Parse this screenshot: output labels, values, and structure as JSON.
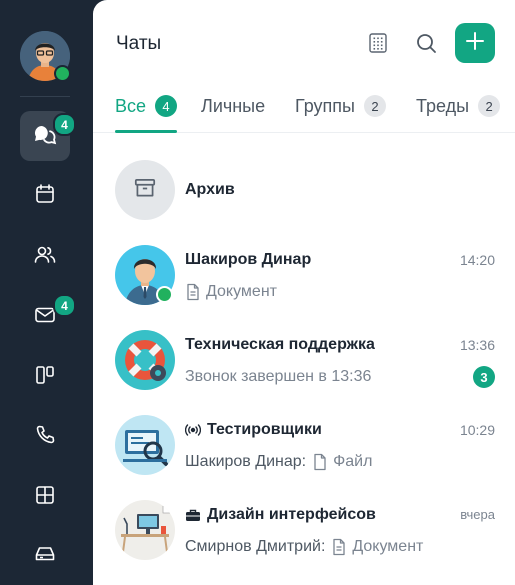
{
  "header": {
    "title": "Чаты"
  },
  "sidebar": {
    "chats_badge": "4",
    "mail_badge": "4"
  },
  "tabs": [
    {
      "label": "Все",
      "count": "4"
    },
    {
      "label": "Личные",
      "count": ""
    },
    {
      "label": "Группы",
      "count": "2"
    },
    {
      "label": "Треды",
      "count": "2"
    }
  ],
  "archive": {
    "label": "Архив"
  },
  "chats": [
    {
      "name": "Шакиров Динар",
      "time": "14:20",
      "sender": "",
      "message": "Документ",
      "unread": ""
    },
    {
      "name": "Техническая поддержка",
      "time": "13:36",
      "sender": "",
      "message": "Звонок завершен в 13:36",
      "unread": "3"
    },
    {
      "name": "Тестировщики",
      "time": "10:29",
      "sender": "Шакиров Динар:",
      "message": "Файл",
      "unread": ""
    },
    {
      "name": "Дизайн интерфейсов",
      "time": "вчера",
      "sender": "Смирнов Дмитрий:",
      "message": "Документ",
      "unread": ""
    }
  ],
  "colors": {
    "accent": "#12a683",
    "sidebar": "#1c2735",
    "online": "#21b15e"
  },
  "icons": [
    "chats-icon",
    "calendar-icon",
    "contacts-icon",
    "mail-icon",
    "boards-icon",
    "phone-icon",
    "apps-icon",
    "storage-icon",
    "qr-code-icon",
    "search-icon",
    "plus-icon",
    "archive-icon",
    "document-icon",
    "file-icon",
    "broadcast-icon",
    "briefcase-icon"
  ]
}
